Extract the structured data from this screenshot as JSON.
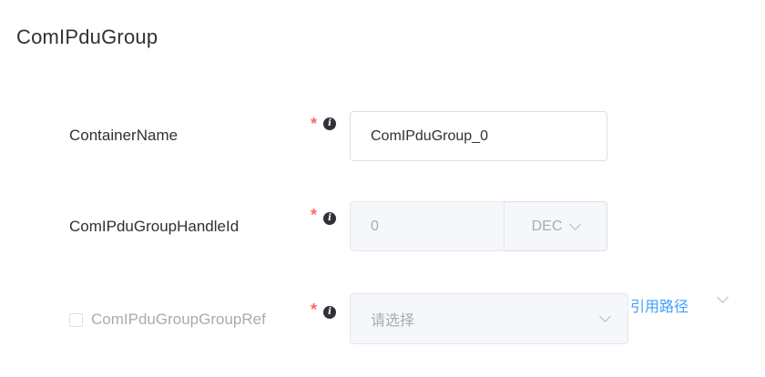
{
  "page": {
    "title": "ComIPduGroup"
  },
  "form": {
    "container_name": {
      "label": "ContainerName",
      "required_mark": "*",
      "info_glyph": "i",
      "value": "ComIPduGroup_0"
    },
    "handle_id": {
      "label": "ComIPduGroupHandleId",
      "required_mark": "*",
      "info_glyph": "i",
      "value": "0",
      "radix": "DEC"
    },
    "group_ref": {
      "label": "ComIPduGroupGroupRef",
      "required_mark": "*",
      "info_glyph": "i",
      "checked": false,
      "placeholder": "请选择",
      "ref_path_label": "引用路径"
    }
  },
  "colors": {
    "required": "#f56c6c",
    "link": "#409eff",
    "disabled_bg": "#f5f7fa",
    "border": "#dcdfe6"
  },
  "icons": {
    "info": "info-circle-icon",
    "dropdown": "chevron-down-icon"
  }
}
